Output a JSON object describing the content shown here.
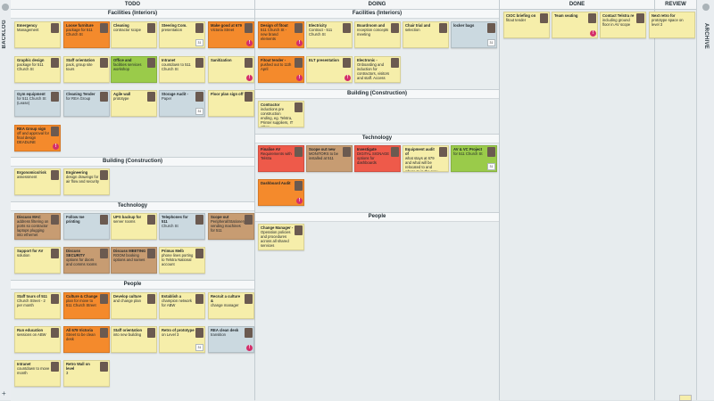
{
  "rails": {
    "backlog": "BACKLOG",
    "archive": "ARCHIVE"
  },
  "columns": {
    "todo": "TODO",
    "doing": "DOING",
    "done": "DONE",
    "review": "REVIEW"
  },
  "lanes": {
    "facilities": "Facilities (Interiors)",
    "building": "Building (Construction)",
    "technology": "Technology",
    "people": "People"
  },
  "cards": {
    "todo": {
      "c1": {
        "t": "Emergency",
        "d": "Management",
        "color": "y"
      },
      "c2": {
        "t": "Loose furniture",
        "d": "package for 511 Church St",
        "color": "o"
      },
      "c3": {
        "t": "Cleaning",
        "d": "contractor scope",
        "color": "y"
      },
      "c4": {
        "t": "Steering Com.",
        "d": "presentation",
        "color": "y"
      },
      "c5": {
        "t": "Make good at 679",
        "d": "Victoria Street",
        "color": "o"
      },
      "c6": {
        "t": "Graphic design",
        "d": "package for 511 Church St",
        "color": "y"
      },
      "c7": {
        "t": "Staff orientation",
        "d": "pack, group site tours",
        "color": "y"
      },
      "c8": {
        "t": "Office and",
        "d": "facilities services workshop",
        "color": "g"
      },
      "c9": {
        "t": "Intranet",
        "d": "countdown to 511 Church St",
        "color": "y"
      },
      "c10": {
        "t": "Sanitization",
        "d": "",
        "color": "y"
      },
      "c11": {
        "t": "Gym equipment",
        "d": "for 511 Church St (Lease)",
        "color": "b"
      },
      "c12": {
        "t": "Cleaning Tender",
        "d": "for REA Group",
        "color": "b"
      },
      "c13": {
        "t": "Agile wall",
        "d": "prototype",
        "color": "y"
      },
      "c14": {
        "t": "Storage Audit -",
        "d": "Paper",
        "color": "b"
      },
      "c15": {
        "t": "Floor plan sign off",
        "d": "",
        "color": "y"
      },
      "c16": {
        "t": "REA Group sign",
        "d": "off and approval for final design DEADLINE",
        "color": "o"
      },
      "c17": {
        "t": "Ergonomics/risk",
        "d": "assessment",
        "color": "y"
      },
      "c18": {
        "t": "Engineering",
        "d": "design drawings for air flow and security",
        "color": "y"
      },
      "c19": {
        "t": "Discuss MAC",
        "d": "address filtering on ports so contractor laptops plugging into ethernet",
        "color": "tn"
      },
      "c20": {
        "t": "Follow me printing",
        "d": "",
        "color": "b"
      },
      "c21": {
        "t": "UPS backup for",
        "d": "server rooms",
        "color": "y"
      },
      "c22": {
        "t": "Telephones for 511",
        "d": "Church St",
        "color": "b"
      },
      "c23": {
        "t": "Scope out",
        "d": "Peripheral/Stationery vending machines for 511",
        "color": "tn"
      },
      "c24": {
        "t": "Support for AV",
        "d": "solution",
        "color": "y"
      },
      "c25": {
        "t": "Discuss SECURITY",
        "d": "options for doors and comms rooms",
        "color": "tn"
      },
      "c26": {
        "t": "Discuss MEETING",
        "d": "ROOM booking options and names",
        "color": "tn"
      },
      "c27": {
        "t": "Primus Melb",
        "d": "phone lines porting to Telstra National account",
        "color": "y"
      },
      "c28": {
        "t": "Staff tours of 511",
        "d": "Church Street - 2 per month",
        "color": "y"
      },
      "c29": {
        "t": "Culture & Change",
        "d": "plan for move to 511 Church Street",
        "color": "o"
      },
      "c30": {
        "t": "Develop culture",
        "d": "and change plan",
        "color": "y"
      },
      "c31": {
        "t": "Establish a",
        "d": "champion network for ABW",
        "color": "y"
      },
      "c32": {
        "t": "Recruit a culture &",
        "d": "change manager",
        "color": "y"
      },
      "c33": {
        "t": "Run education",
        "d": "sessions on ABW",
        "color": "y"
      },
      "c34": {
        "t": "All 679 Victoria",
        "d": "Street to be clean desk",
        "color": "o"
      },
      "c35": {
        "t": "Staff orientation",
        "d": "into new building",
        "color": "y"
      },
      "c36": {
        "t": "Retro of prototype",
        "d": "on Level 3",
        "color": "y"
      },
      "c37": {
        "t": "REA clean desk",
        "d": "transition",
        "color": "b"
      },
      "c38": {
        "t": "Intranet",
        "d": "countdown to move month",
        "color": "y"
      },
      "c39": {
        "t": "Retro Wall on level",
        "d": "3",
        "color": "y"
      }
    },
    "doing": {
      "d1": {
        "t": "Design of fitout",
        "d": "511 Church St - new brand elements",
        "color": "o"
      },
      "d2": {
        "t": "Electricity",
        "d": "Contract - 511 Church St",
        "color": "y"
      },
      "d3": {
        "t": "Boardroom and",
        "d": "reception concepts meeting",
        "color": "y"
      },
      "d4": {
        "t": "Chair trial and",
        "d": "selection",
        "color": "y"
      },
      "d5": {
        "t": "locker bags",
        "d": "",
        "color": "b"
      },
      "d6": {
        "t": "Fitout tender -",
        "d": "pushed out to 11th April",
        "color": "o"
      },
      "d7": {
        "t": "ELT presentation",
        "d": "",
        "color": "y"
      },
      "d8": {
        "t": "Electronic -",
        "d": "Onboarding and induction for contractors, visitors and staff. Access",
        "color": "y"
      },
      "d9": {
        "t": "Contractor",
        "d": "inductions pre construction ending, eg. Telstra, Printer suppliers, IT other",
        "color": "y"
      },
      "d10": {
        "t": "Finalise AV",
        "d": "Requirements with Telstra",
        "color": "r"
      },
      "d11": {
        "t": "Scope out new",
        "d": "MONITORS to be installed at 511",
        "color": "tn"
      },
      "d12": {
        "t": "Investigate",
        "d": "DIGITAL SIGNAGE options for dashboards",
        "color": "r"
      },
      "d13": {
        "t": "Equipment audit of",
        "d": "what stays at 679 and what will be relocated to and where to in the new",
        "color": "y"
      },
      "d14": {
        "t": "AV & VC Project",
        "d": "for 511 Church St",
        "color": "g"
      },
      "d15": {
        "t": "Dashboard Audit",
        "d": "",
        "color": "o"
      },
      "d16": {
        "t": "Change Manager -",
        "d": "Operation policies and procedures across all shared services",
        "color": "y"
      }
    },
    "done": {
      "n1": {
        "t": "CIOC briefing on",
        "d": "fitout tender",
        "color": "y"
      },
      "n2": {
        "t": "Team seating",
        "d": "",
        "color": "y"
      },
      "n3": {
        "t": "Contact Telstra re",
        "d": "including ground floor in AV scope",
        "color": "y"
      }
    },
    "review": {
      "r1": {
        "t": "Next retro for",
        "d": "prototype space on level 3",
        "color": "y"
      }
    }
  },
  "badges": {
    "alert": "!",
    "cal": "31"
  },
  "colors": {
    "yellow": "#f6eeaa",
    "orange": "#f48a2c",
    "blue": "#cbd9e0",
    "green": "#9acb4a",
    "red": "#ee5a4a",
    "tan": "#c79c72"
  }
}
